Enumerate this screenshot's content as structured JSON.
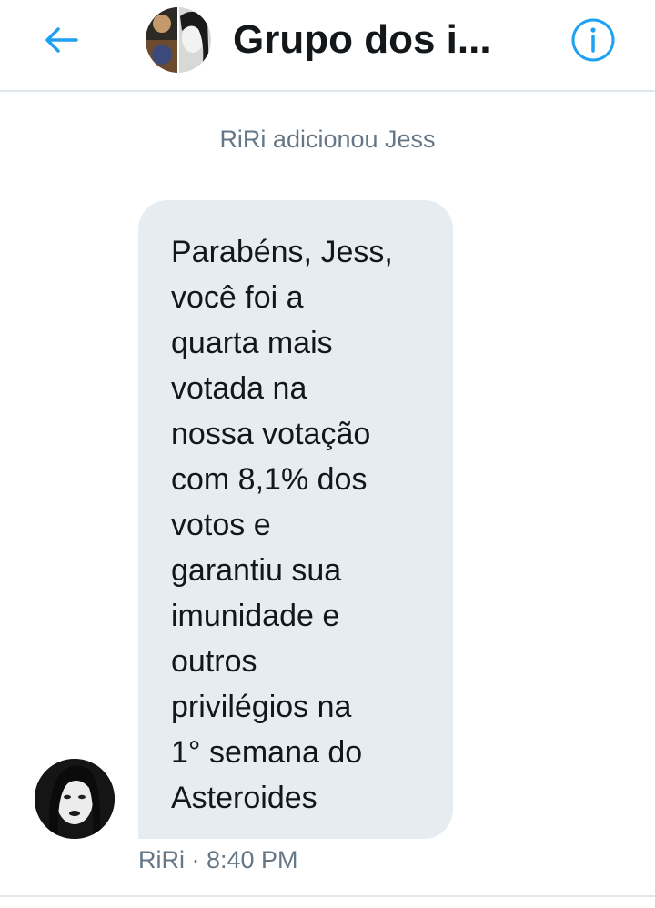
{
  "header": {
    "title": "Grupo dos i...",
    "back_icon": "arrow-left-icon",
    "info_icon": "info-circle-icon",
    "accent_color": "#1da1f2"
  },
  "conversation": {
    "system_message": "RiRi adicionou Jess",
    "messages": [
      {
        "sender": "RiRi",
        "time": "8:40 PM",
        "lines": [
          "Parabéns, Jess,",
          "você foi a",
          "quarta mais",
          "votada na",
          "nossa votação",
          "com 8,1% dos",
          "votos e",
          "garantiu sua",
          "imunidade e",
          "outros",
          "privilégios na",
          "1° semana do",
          "Asteroides"
        ],
        "meta": "RiRi · 8:40 PM"
      }
    ]
  },
  "colors": {
    "bubble_bg": "#e6ecf0",
    "text_primary": "#14171a",
    "text_secondary": "#657786",
    "divider": "#e1e8ed"
  }
}
